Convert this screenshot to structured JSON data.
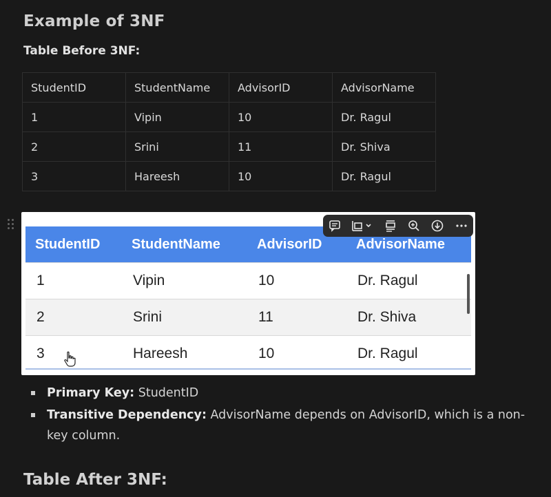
{
  "heading": "Example of 3NF",
  "subheading": "Table Before 3NF:",
  "table": {
    "headers": [
      "StudentID",
      "StudentName",
      "AdvisorID",
      "AdvisorName"
    ],
    "rows": [
      [
        "1",
        "Vipin",
        "10",
        "Dr. Ragul"
      ],
      [
        "2",
        "Srini",
        "11",
        "Dr. Shiva"
      ],
      [
        "3",
        "Hareesh",
        "10",
        "Dr. Ragul"
      ]
    ]
  },
  "image_table": {
    "headers": [
      "StudentID",
      "StudentName",
      "AdvisorID",
      "AdvisorName"
    ],
    "rows": [
      [
        "1",
        "Vipin",
        "10",
        "Dr. Ragul"
      ],
      [
        "2",
        "Srini",
        "11",
        "Dr. Shiva"
      ],
      [
        "3",
        "Hareesh",
        "10",
        "Dr. Ragul"
      ]
    ]
  },
  "image_toolbar": {
    "icons": [
      "comment-icon",
      "align-icon",
      "chevron-down-icon",
      "caption-icon",
      "zoom-in-icon",
      "download-icon",
      "more-icon"
    ]
  },
  "bullets": [
    {
      "label": "Primary Key:",
      "text": " StudentID"
    },
    {
      "label": "Transitive Dependency:",
      "text": " AdvisorName depends on AdvisorID, which is a non-key column."
    }
  ],
  "next_heading": "Table After 3NF:"
}
